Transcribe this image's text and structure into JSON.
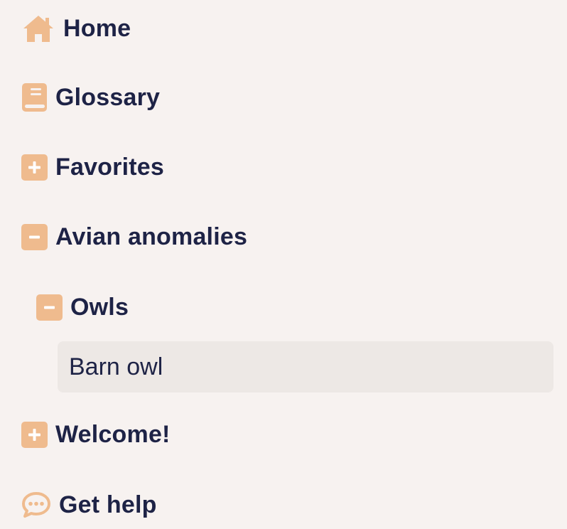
{
  "colors": {
    "background": "#f7f2f0",
    "icon": "#efbb8e",
    "text": "#1e2346",
    "selected_background": "#ede8e5"
  },
  "nav": {
    "items": [
      {
        "label": "Home",
        "icon": "home-icon"
      },
      {
        "label": "Glossary",
        "icon": "book-icon"
      },
      {
        "label": "Favorites",
        "icon": "expand-plus-icon",
        "state": "collapsed"
      },
      {
        "label": "Avian anomalies",
        "icon": "collapse-minus-icon",
        "state": "expanded",
        "children": [
          {
            "label": "Owls",
            "icon": "collapse-minus-icon",
            "state": "expanded",
            "children": [
              {
                "label": "Barn owl",
                "selected": true
              }
            ]
          }
        ]
      },
      {
        "label": "Welcome!",
        "icon": "expand-plus-icon",
        "state": "collapsed"
      },
      {
        "label": "Get help",
        "icon": "chat-bubble-icon"
      }
    ]
  }
}
